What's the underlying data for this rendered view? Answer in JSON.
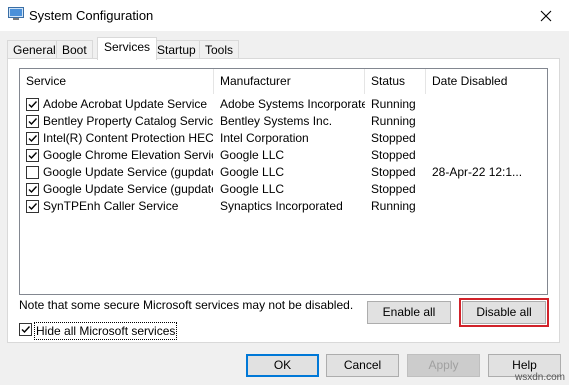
{
  "window": {
    "title": "System Configuration"
  },
  "tabs": [
    {
      "label": "General"
    },
    {
      "label": "Boot"
    },
    {
      "label": "Services"
    },
    {
      "label": "Startup"
    },
    {
      "label": "Tools"
    }
  ],
  "active_tab": "Services",
  "table": {
    "columns": [
      "Service",
      "Manufacturer",
      "Status",
      "Date Disabled"
    ],
    "rows": [
      {
        "service": "Adobe Acrobat Update Service",
        "manufacturer": "Adobe Systems Incorporated",
        "status": "Running",
        "date": "",
        "checked": true
      },
      {
        "service": "Bentley Property Catalog Service",
        "manufacturer": "Bentley Systems Inc.",
        "status": "Running",
        "date": "",
        "checked": true
      },
      {
        "service": "Intel(R) Content Protection HEC...",
        "manufacturer": "Intel Corporation",
        "status": "Stopped",
        "date": "",
        "checked": true
      },
      {
        "service": "Google Chrome Elevation Servic...",
        "manufacturer": "Google LLC",
        "status": "Stopped",
        "date": "",
        "checked": true
      },
      {
        "service": "Google Update Service (gupdate)",
        "manufacturer": "Google LLC",
        "status": "Stopped",
        "date": "28-Apr-22 12:1...",
        "checked": false
      },
      {
        "service": "Google Update Service (gupdatem)",
        "manufacturer": "Google LLC",
        "status": "Stopped",
        "date": "",
        "checked": true
      },
      {
        "service": "SynTPEnh Caller Service",
        "manufacturer": "Synaptics Incorporated",
        "status": "Running",
        "date": "",
        "checked": true
      }
    ]
  },
  "note": "Note that some secure Microsoft services may not be disabled.",
  "buttons": {
    "enable_all": "Enable all",
    "disable_all": "Disable all",
    "ok": "OK",
    "cancel": "Cancel",
    "apply": "Apply",
    "help": "Help"
  },
  "hide_ms": {
    "label": "Hide all Microsoft services",
    "checked": true
  },
  "watermark": "wsxdn.com",
  "colors": {
    "highlight": "#d1222a",
    "focus": "#0078d7"
  },
  "icons": {
    "app": "system-configuration-icon",
    "close": "close-icon",
    "check": "checkmark-icon"
  }
}
